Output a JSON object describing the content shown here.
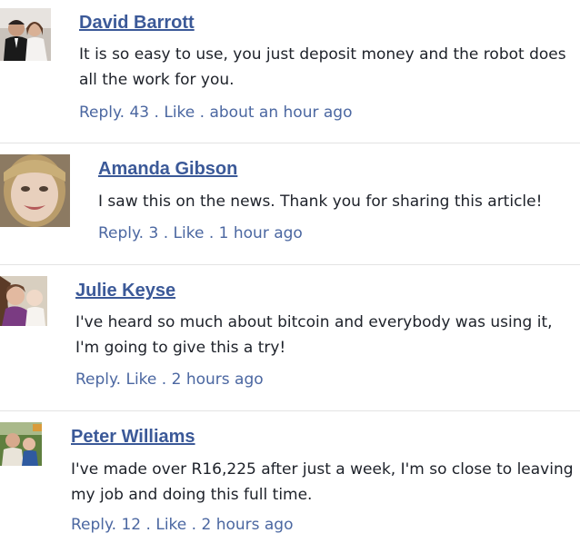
{
  "comments": [
    {
      "author": "David Barrott",
      "text": "It is so easy to use, you just deposit money and the robot does all the work for you.",
      "reply": "Reply",
      "count": "43",
      "like": "Like",
      "time": "about an hour ago",
      "avatar_icon": "wedding-couple-photo"
    },
    {
      "author": "Amanda Gibson",
      "text": "I saw this on the news. Thank you for sharing this article!",
      "reply": "Reply",
      "count": "3",
      "like": "Like",
      "time": "1 hour ago",
      "avatar_icon": "smiling-woman-photo"
    },
    {
      "author": "Julie Keyse",
      "text": "I've heard so much about bitcoin and everybody was using it, I'm going to give this a try!",
      "reply": "Reply",
      "like": "Like",
      "time": "2 hours ago",
      "avatar_icon": "woman-with-baby-photo"
    },
    {
      "author": "Peter Williams",
      "text": "I've made over R16,225 after just a week, I'm so close to leaving my job and doing this full time.",
      "reply": "Reply",
      "count": "12",
      "like": "Like",
      "time": "2 hours ago",
      "avatar_icon": "man-with-child-photo"
    }
  ],
  "colors": {
    "link": "#3b5998",
    "meta": "#4b67a1",
    "text": "#1d2129",
    "separator": "#e3e3e3"
  }
}
